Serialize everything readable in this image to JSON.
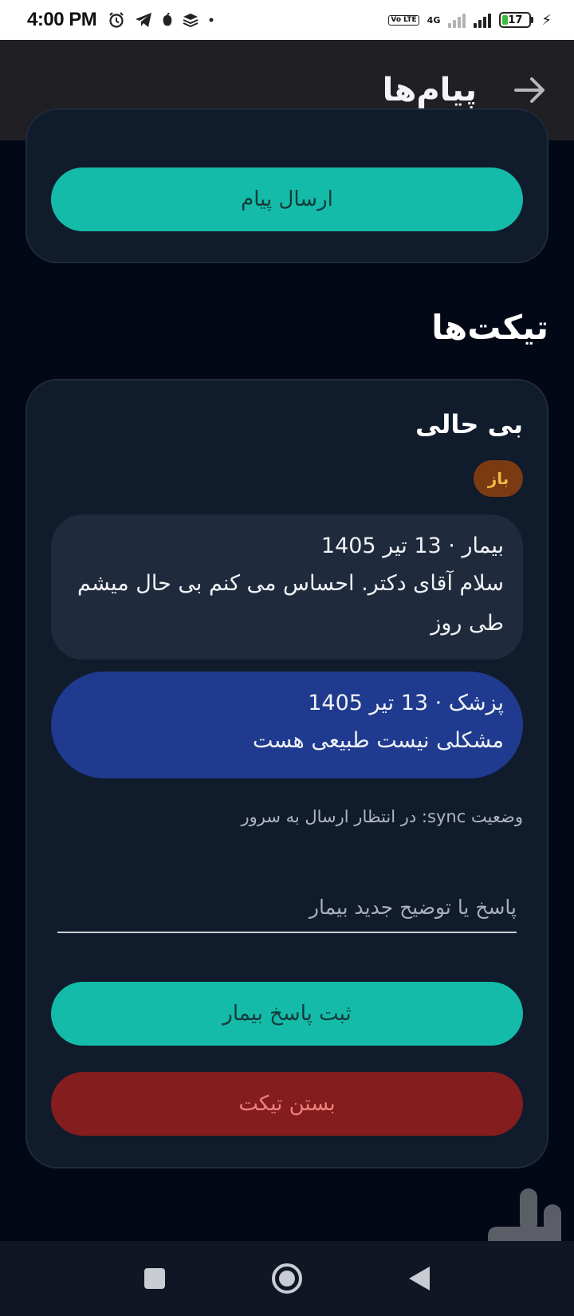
{
  "status_bar": {
    "time": "4:00 PM",
    "battery": "17",
    "network": "4G",
    "volte": "Vo LTE",
    "left_icons": [
      "alarm-icon",
      "telegram-icon",
      "app-icon",
      "layers-icon",
      "dot-icon"
    ]
  },
  "app_bar": {
    "title": "پیام‌ها",
    "back_icon": "arrow-right-icon"
  },
  "message_form": {
    "send_label": "ارسال پیام"
  },
  "tickets": {
    "section_title": "تیکت‌ها",
    "items": [
      {
        "title": "بی حالی",
        "status_badge": "باز",
        "messages": [
          {
            "meta": "بیمار · 13 تیر 1405",
            "text": "سلام آقای دکتر. احساس می کنم بی حال میشم طی روز"
          },
          {
            "meta": "پزشک · 13 تیر 1405",
            "text": "مشکلی نیست طبیعی هست"
          }
        ],
        "sync_status": "وضعیت sync: در انتظار ارسال به سرور",
        "reply_placeholder": "پاسخ یا توضیح جدید بیمار",
        "reply_value": "",
        "submit_label": "ثبت پاسخ بیمار",
        "close_label": "بستن تیکت"
      }
    ]
  },
  "colors": {
    "background": "#030816",
    "card": "#101b2c",
    "accent_teal": "#14bba8",
    "danger": "#841d1d",
    "doctor_bubble": "#1f3a8e",
    "patient_bubble": "#202a3d",
    "badge": "#7a3a12"
  },
  "nav_bar": {
    "icons": [
      "recents-square-icon",
      "home-circle-icon",
      "back-triangle-icon"
    ]
  }
}
